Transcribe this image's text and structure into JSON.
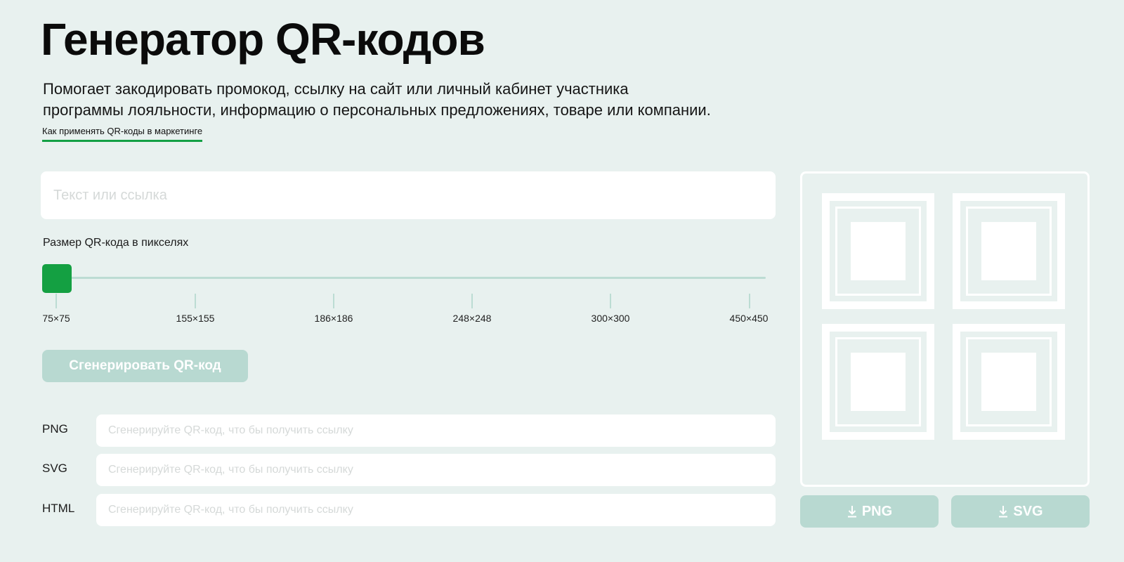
{
  "header": {
    "title": "Генератор QR-кодов",
    "description": "Помогает закодировать промокод, ссылку на сайт или личный кабинет участника\nпрограммы лояльности, информацию о персональных предложениях, товаре или компании.",
    "link": "Как применять QR-коды в маркетинге"
  },
  "form": {
    "text_placeholder": "Текст или ссылка",
    "text_value": "",
    "size_label": "Размер QR-кода в пикселях",
    "selected_size": "75×75",
    "size_options": [
      "75×75",
      "155×155",
      "186×186",
      "248×248",
      "300×300",
      "450×450"
    ],
    "generate_label": "Сгенерировать QR-код"
  },
  "outputs": [
    {
      "label": "PNG",
      "placeholder": "Сгенерируйте QR-код, что бы получить ссылку",
      "value": ""
    },
    {
      "label": "SVG",
      "placeholder": "Сгенерируйте QR-код, что бы получить ссылку",
      "value": ""
    },
    {
      "label": "HTML",
      "placeholder": "Сгенерируйте QR-код, что бы получить ссылку",
      "value": ""
    }
  ],
  "download": {
    "png_label": "PNG",
    "svg_label": "SVG",
    "icon": "download-icon"
  },
  "colors": {
    "background": "#e8f1ef",
    "accent": "#14a042",
    "disabled_button": "#b8d9d1",
    "slider_track": "#bcdcd3"
  }
}
